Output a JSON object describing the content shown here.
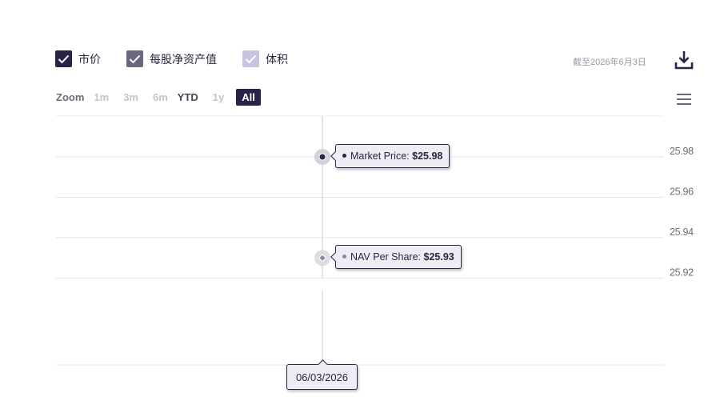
{
  "legend": {
    "items": [
      {
        "label": "市价",
        "color": "#2b2347"
      },
      {
        "label": "每股净资产值",
        "color": "#6b6780"
      },
      {
        "label": "体积",
        "color": "#c9c2e2"
      }
    ]
  },
  "as_of": "截至2026年6月3日",
  "icons": {
    "download": "download-icon",
    "menu": "hamburger-menu-icon",
    "check": "check-icon"
  },
  "zoom": {
    "label": "Zoom",
    "buttons": [
      "1m",
      "3m",
      "6m",
      "YTD",
      "1y",
      "All"
    ],
    "active": "All"
  },
  "tooltips": {
    "market_price": {
      "name": "Market Price:",
      "value": "$25.98"
    },
    "nav": {
      "name": "NAV Per Share:",
      "value": "$25.93"
    },
    "date": "06/03/2026"
  },
  "colors": {
    "accent": "#2b2347",
    "market_price": "#2b2347",
    "nav": "#8a86a0",
    "grid": "#e6e6ea",
    "crosshair": "#c8c8cc"
  },
  "chart_data": {
    "type": "line",
    "x": [
      "06/03/2026"
    ],
    "series": [
      {
        "name": "Market Price",
        "values": [
          25.98
        ]
      },
      {
        "name": "NAV Per Share",
        "values": [
          25.93
        ]
      }
    ],
    "y_ticks": [
      "25.98",
      "25.96",
      "25.94",
      "25.92"
    ],
    "y_tick_values": [
      25.98,
      25.96,
      25.94,
      25.92
    ],
    "ylim": [
      25.9,
      26.0
    ],
    "grid": true
  }
}
